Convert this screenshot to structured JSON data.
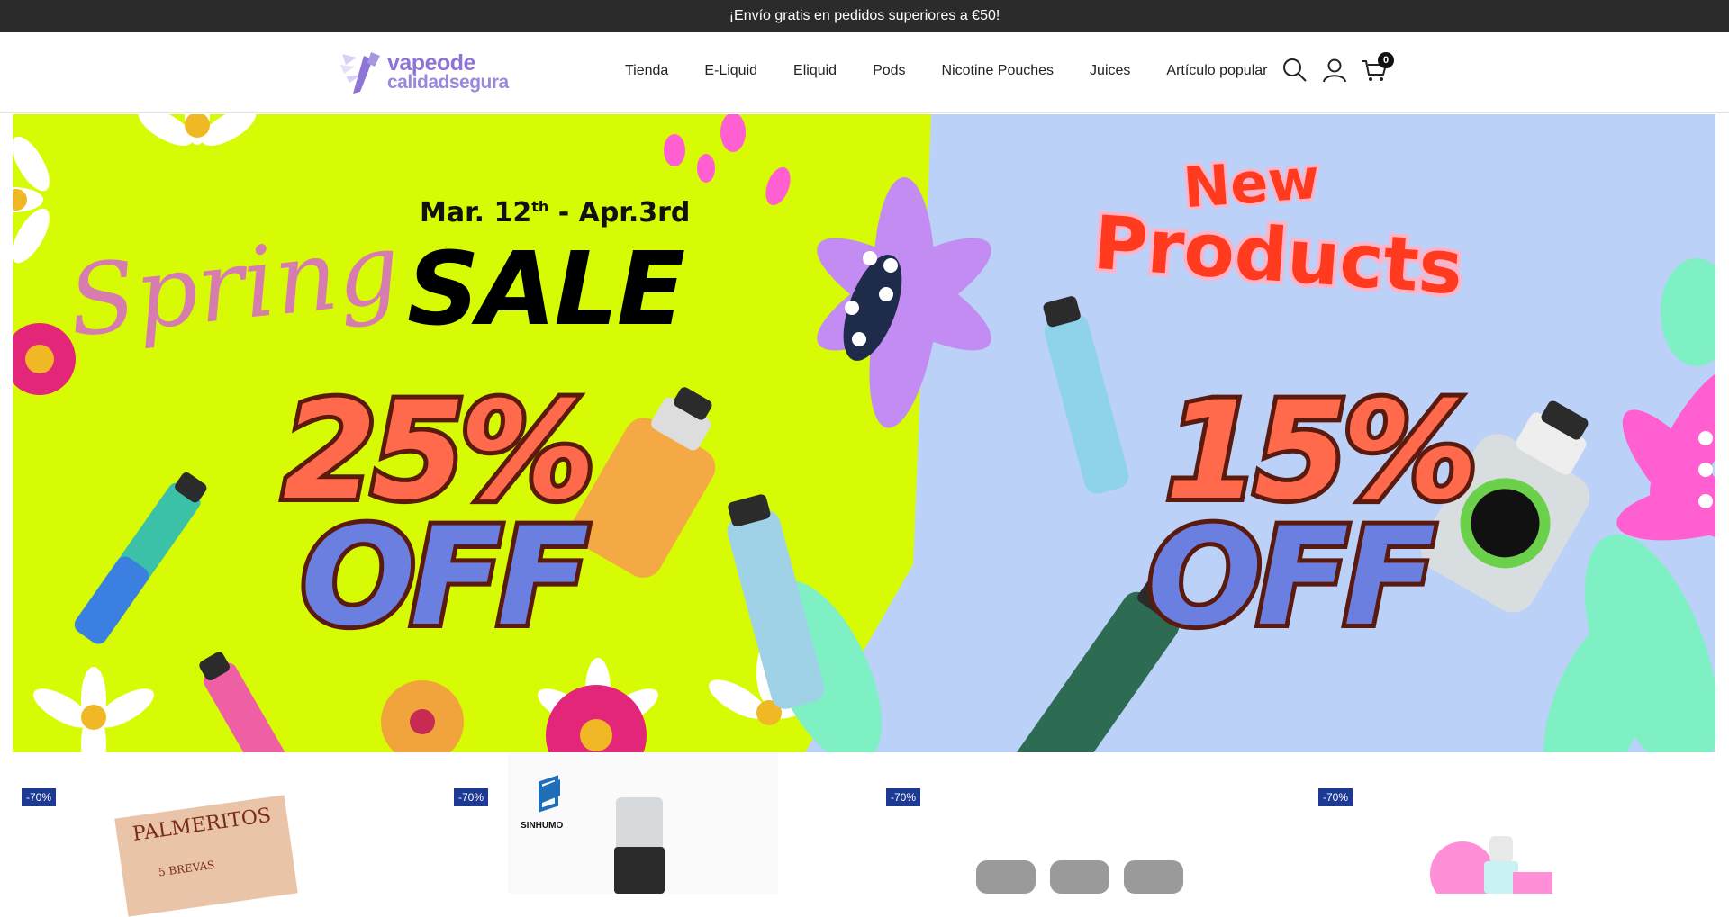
{
  "announcement": {
    "text": "¡Envío gratis en pedidos superiores a €50!"
  },
  "header": {
    "logo": {
      "line1": "vapeode",
      "line2": "calidadsegura"
    },
    "nav": [
      {
        "label": "Tienda"
      },
      {
        "label": "E-Liquid"
      },
      {
        "label": "Eliquid"
      },
      {
        "label": "Pods"
      },
      {
        "label": "Nicotine Pouches"
      },
      {
        "label": "Juices"
      },
      {
        "label": "Artículo popular"
      }
    ],
    "icons": {
      "search": "search-icon",
      "account": "user-icon",
      "cart": "cart-icon"
    },
    "cart_count": "0"
  },
  "hero": {
    "left": {
      "script_word": "Spring",
      "dates_start": "Mar. 12",
      "dates_sup": "th",
      "dates_end": " - Apr.3rd",
      "sale_word": "SALE",
      "percent": "25%",
      "off": "OFF",
      "background": "#d6fb05"
    },
    "right": {
      "new_word": "New",
      "products_word": "Products",
      "percent": "15%",
      "off": "OFF",
      "background": "#bcd1f8"
    }
  },
  "products": [
    {
      "badge": "-70%",
      "image_text": "PALMERITOS",
      "image_subtext": "5 BREVAS"
    },
    {
      "badge": "-70%",
      "image_text": "SINHUMO"
    },
    {
      "badge": "-70%"
    },
    {
      "badge": "-70%"
    }
  ],
  "colors": {
    "badge": "#1c3a94",
    "announcement_bg": "#2b2b2b",
    "logo": "#8f74d8"
  }
}
